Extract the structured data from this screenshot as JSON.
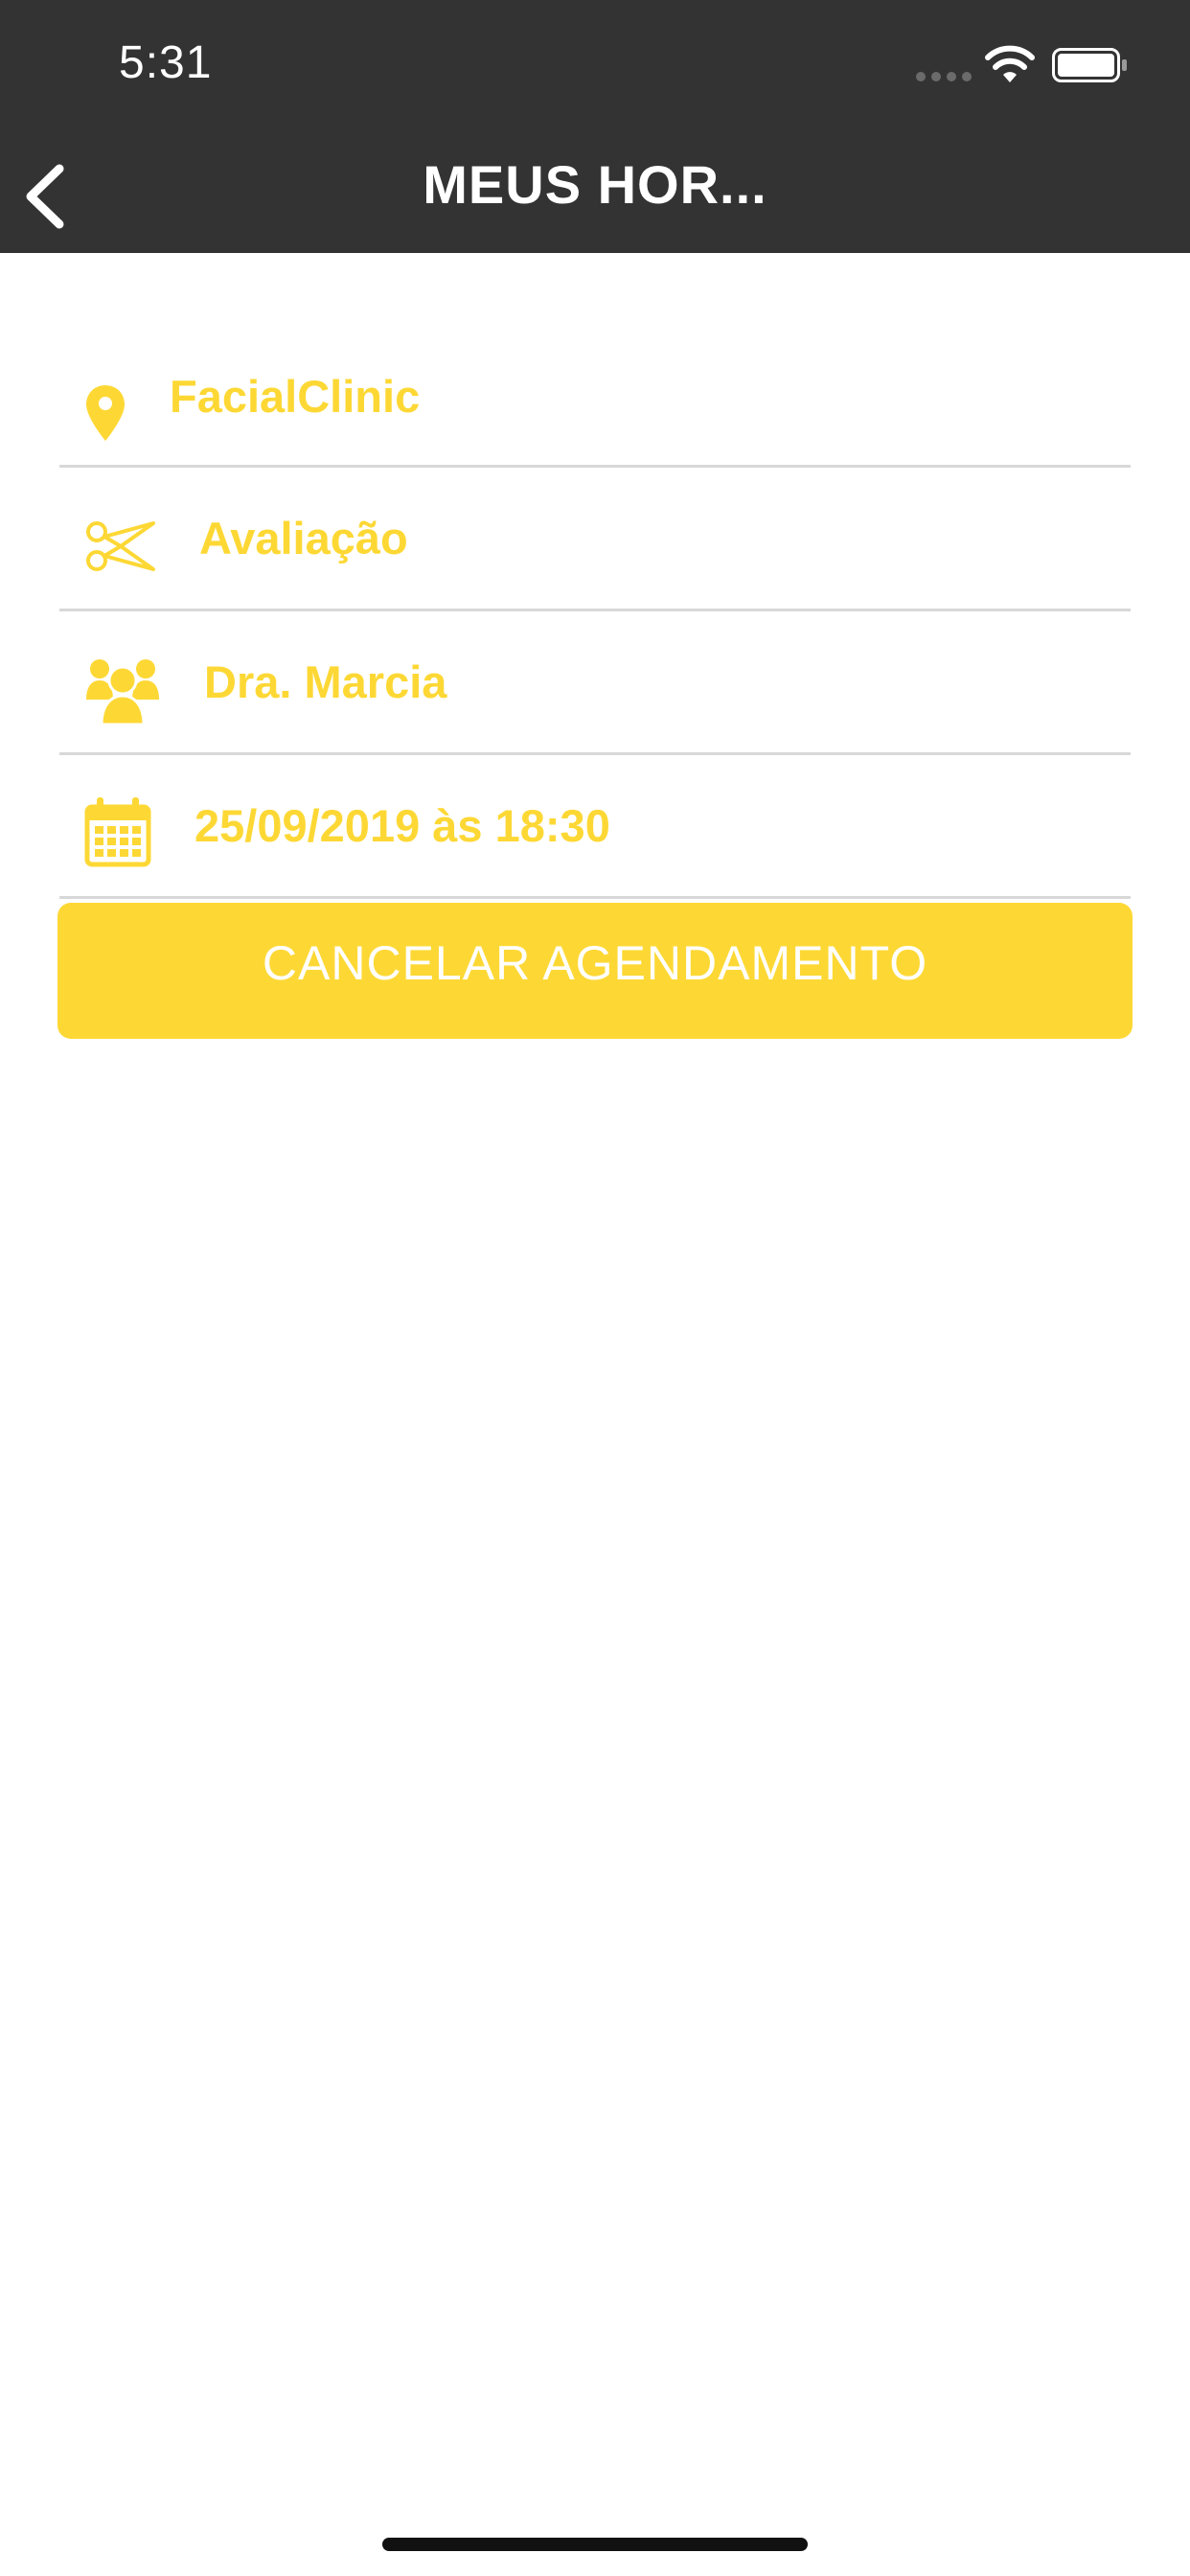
{
  "status_bar": {
    "time": "5:31",
    "icons": [
      "cellular-signal-icon",
      "wifi-icon",
      "battery-icon"
    ]
  },
  "nav": {
    "title": "MEUS HOR...",
    "back_icon": "chevron-left-icon"
  },
  "details": [
    {
      "icon": "location-pin-icon",
      "label": "FacialClinic"
    },
    {
      "icon": "scissors-icon",
      "label": "Avaliação"
    },
    {
      "icon": "people-group-icon",
      "label": "Dra. Marcia"
    },
    {
      "icon": "calendar-icon",
      "label": "25/09/2019 às 18:30"
    }
  ],
  "actions": {
    "cancel_label": "CANCELAR AGENDAMENTO"
  },
  "colors": {
    "header_bg": "#333333",
    "accent_yellow": "#FDD835",
    "divider": "#D8D8D8",
    "background": "#FFFFFF"
  }
}
